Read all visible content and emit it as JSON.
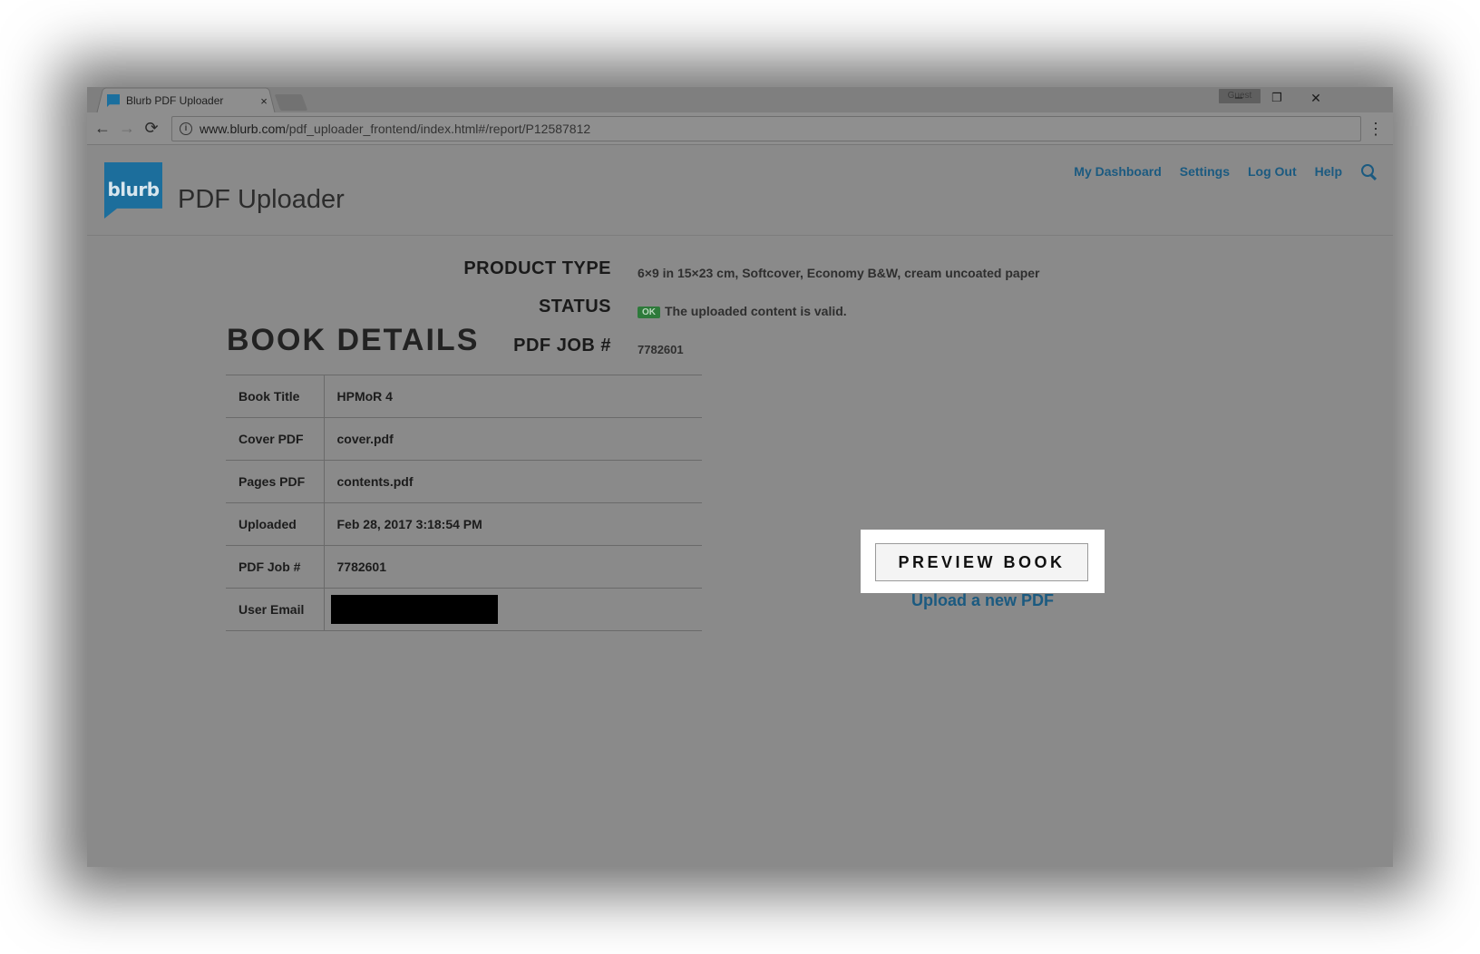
{
  "browser": {
    "tab_title": "Blurb PDF Uploader",
    "tab_close": "×",
    "profile_label": "Guest",
    "window_controls": {
      "minimize": "–",
      "restore": "❐",
      "close": "✕"
    },
    "nav": {
      "back": "←",
      "forward": "→",
      "reload": "⟳"
    },
    "url_host": "www.blurb.com",
    "url_path": "/pdf_uploader_frontend/index.html#/report/P12587812",
    "menu": "⋮"
  },
  "header": {
    "logo_text": "blurb",
    "app_title": "PDF Uploader",
    "nav_items": [
      "My Dashboard",
      "Settings",
      "Log Out",
      "Help"
    ]
  },
  "summary": {
    "product_type_label": "PRODUCT TYPE",
    "product_type_value": "6×9 in 15×23 cm, Softcover, Economy B&W, cream uncoated paper",
    "status_label": "STATUS",
    "status_badge": "OK",
    "status_text": "The uploaded content is valid.",
    "pdf_job_label": "PDF JOB #",
    "pdf_job_value": "7782601"
  },
  "book_details": {
    "title": "BOOK DETAILS",
    "rows": [
      {
        "key": "Book Title",
        "value": "HPMoR 4"
      },
      {
        "key": "Cover PDF",
        "value": "cover.pdf"
      },
      {
        "key": "Pages PDF",
        "value": "contents.pdf"
      },
      {
        "key": "Uploaded",
        "value": "Feb 28, 2017 3:18:54 PM"
      },
      {
        "key": "PDF Job #",
        "value": "7782601"
      },
      {
        "key": "User Email",
        "value": ""
      }
    ]
  },
  "actions": {
    "preview_label": "PREVIEW BOOK",
    "upload_label": "Upload a new PDF"
  },
  "colors": {
    "brand_blue": "#1c6e9c",
    "link_blue": "#1b5a80",
    "ok_green": "#2d7a3a",
    "overlay_gray": "#8a8a8a"
  }
}
